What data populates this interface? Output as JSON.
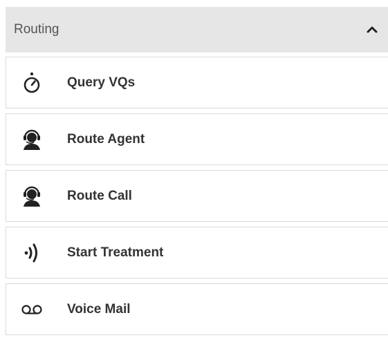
{
  "section": {
    "title": "Routing",
    "collapse_icon": "chevron-up-icon"
  },
  "items": [
    {
      "label": "Query VQs",
      "icon": "stopwatch-icon"
    },
    {
      "label": "Route Agent",
      "icon": "agent-headset-icon"
    },
    {
      "label": "Route Call",
      "icon": "agent-headset-icon"
    },
    {
      "label": "Start Treatment",
      "icon": "audio-waves-icon"
    },
    {
      "label": "Voice Mail",
      "icon": "voicemail-icon"
    }
  ],
  "colors": {
    "header_bg": "#e6e6e6",
    "border": "#d9d9d9",
    "text": "#333333",
    "header_text": "#555555"
  }
}
